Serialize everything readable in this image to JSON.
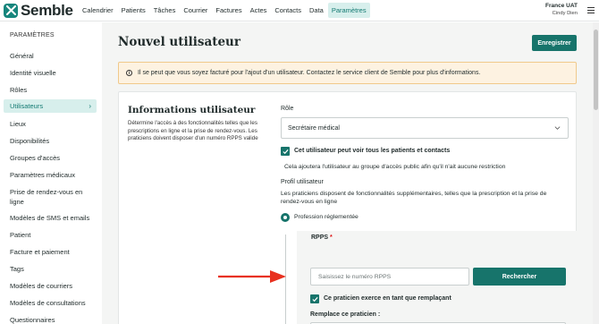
{
  "app": {
    "name": "Semble"
  },
  "nav": {
    "items": [
      "Calendrier",
      "Patients",
      "Tâches",
      "Courrier",
      "Factures",
      "Actes",
      "Contacts",
      "Data",
      "Paramètres"
    ],
    "active": "Paramètres"
  },
  "account": {
    "org": "France UAT",
    "user": "Cindy Dien"
  },
  "sidebar": {
    "heading": "PARAMÈTRES",
    "items": [
      "Général",
      "Identité visuelle",
      "Rôles",
      "Utilisateurs",
      "Lieux",
      "Disponibilités",
      "Groupes d'accès",
      "Paramètres médicaux",
      "Prise de rendez-vous en ligne",
      "Modèles de SMS et emails",
      "Patient",
      "Facture et paiement",
      "Tags",
      "Modèles de courriers",
      "Modèles de consultations",
      "Questionnaires"
    ],
    "active": "Utilisateurs"
  },
  "page": {
    "title": "Nouvel utilisateur",
    "save_label": "Enregistrer",
    "banner": "Il se peut que vous soyez facturé pour l'ajout d'un utilisateur. Contactez le service client de Semble pour plus d'informations."
  },
  "form": {
    "section_title": "Informations utilisateur",
    "section_desc": "Détermine l'accès à des fonctionnalités telles que les prescriptions en ligne et la prise de rendez-vous. Les praticiens doivent disposer d'un numéro RPPS valide",
    "role_label": "Rôle",
    "role_value": "Secrétaire médical",
    "see_all_label": "Cet utilisateur peut voir tous les patients et contacts",
    "see_all_checked": true,
    "see_all_help": "Cela ajoutera l'utilisateur au groupe d'accès public afin qu'il n'ait aucune restriction",
    "profile_label": "Profil utilisateur",
    "profile_desc": "Les praticiens disposent de fonctionnalités supplémentaires, telles que la prescription et la prise de rendez-vous en ligne",
    "profile_option": "Profession réglementée",
    "rpps_label": "RPPS",
    "rpps_required": "*",
    "rpps_placeholder": "Saisissez le numéro RPPS",
    "search_label": "Rechercher",
    "replacement_label": "Ce praticien exerce en tant que remplaçant",
    "replacement_checked": true,
    "replaces_label": "Remplace ce praticien :",
    "replaces_value": ""
  },
  "colors": {
    "brand": "#17746b",
    "active_bg": "#d7efec",
    "banner_bg": "#fdf2e1",
    "annotation_arrow": "#e8311f"
  }
}
